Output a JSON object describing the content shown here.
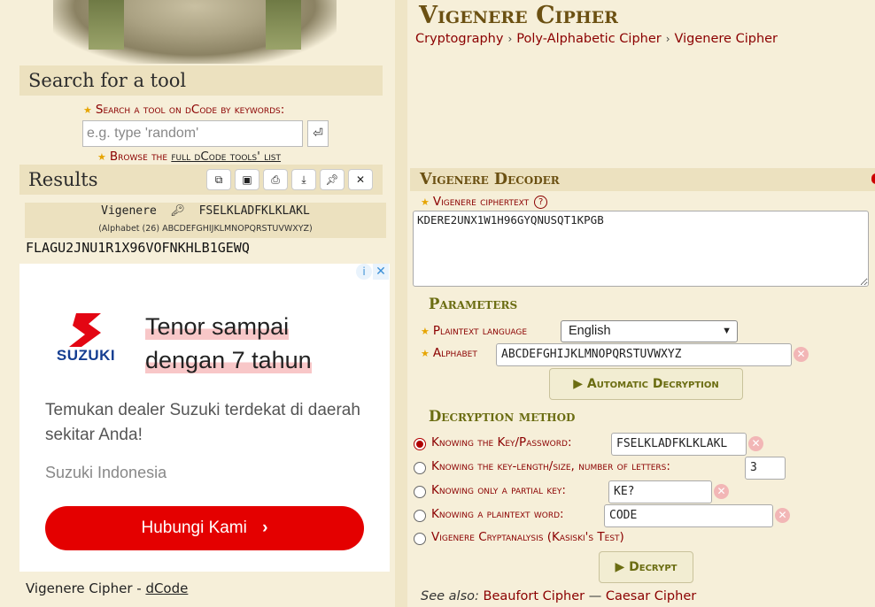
{
  "left": {
    "search": {
      "heading": "Search for a tool",
      "label": "Search a tool on dCode by keywords:",
      "placeholder": "e.g. type 'random'",
      "go_icon": "enter-icon",
      "browse_prefix": "Browse the ",
      "browse_link": "full dCode tools' list"
    },
    "results": {
      "heading": "Results",
      "toolbar_icons": [
        "copy-icon",
        "save-icon",
        "print-icon",
        "download-icon",
        "pin-icon",
        "close-icon"
      ],
      "summary_name": "Vigenere",
      "summary_key": "FSELKLADFKLKLAKL",
      "summary_alphabet": "(Alphabet (26) ABCDEFGHIJKLMNOPQRSTUVWXYZ)",
      "output": "FLAGU2JNU1R1X96VOFNKHLB1GEWQ"
    },
    "ad": {
      "brand": "SUZUKI",
      "headline_line1": "Tenor sampai",
      "headline_line2": "dengan 7 tahun",
      "body": "Temukan dealer Suzuki terdekat di daerah sekitar Anda!",
      "advertiser": "Suzuki Indonesia",
      "cta": "Hubungi Kami",
      "cta_icon": "chevron-right-icon",
      "info_icon": "info-icon",
      "close_icon": "close-icon",
      "brand_color": "#153e91",
      "cta_color": "#e40000"
    },
    "footer": {
      "title": "Vigenere Cipher - ",
      "link": "dCode"
    }
  },
  "right": {
    "page_title": "Vigenere Cipher",
    "breadcrumb": [
      "Cryptography",
      "Poly-Alphabetic Cipher",
      "Vigenere Cipher"
    ],
    "decoder": {
      "title": "Vigenere Decoder",
      "ciphertext_label": "Vigenere ciphertext",
      "ciphertext": "KDERE2UNX1W1H96GYQNUSQT1KPGB",
      "parameters_heading": "Parameters",
      "language_label": "Plaintext language",
      "language_value": "English",
      "alphabet_label": "Alphabet",
      "alphabet_value": "ABCDEFGHIJKLMNOPQRSTUVWXYZ",
      "auto_button": "Automatic Decryption",
      "method_heading": "Decryption method",
      "methods": [
        {
          "label": "Knowing the Key/Password:",
          "value": "FSELKLADFKLKLAKL",
          "selected": true
        },
        {
          "label": "Knowing the key-length/size, number of letters:",
          "value": "3",
          "selected": false
        },
        {
          "label": "Knowing only a partial key:",
          "value": "KE?",
          "selected": false
        },
        {
          "label": "Knowing a plaintext word:",
          "value": "CODE",
          "selected": false
        },
        {
          "label": "Vigenere Cryptanalysis (Kasiski's Test)",
          "value": "",
          "selected": false
        }
      ],
      "decrypt_button": "Decrypt",
      "see_also_label": "See also:",
      "see_also_links": [
        "Beaufort Cipher",
        "Caesar Cipher"
      ],
      "see_also_sep": " — "
    }
  },
  "colors": {
    "background": "#f6efd9",
    "header_band": "#ece1bf",
    "title": "#6b5012",
    "link": "#8b0000",
    "subhead": "#6b6d12"
  }
}
